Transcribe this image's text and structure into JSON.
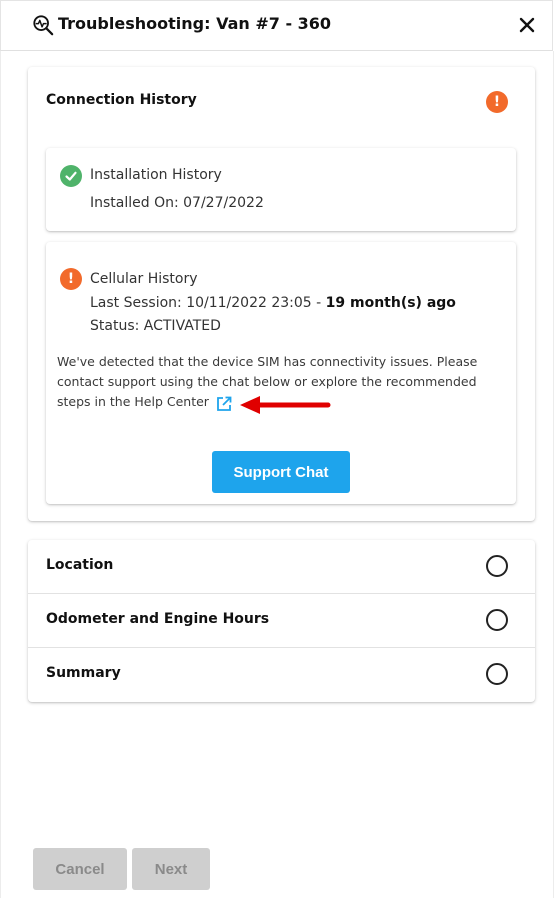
{
  "header": {
    "title": "Troubleshooting: Van #7 - 360",
    "icon": "diagnostic-magnifier-icon",
    "close_icon": "close-icon"
  },
  "connection_history": {
    "title": "Connection History",
    "status": "warning",
    "installation": {
      "title": "Installation History",
      "installed_on": "Installed On: 07/27/2022",
      "status": "success"
    },
    "cellular": {
      "title": "Cellular History",
      "last_session_prefix": "Last Session: 10/11/2022 23:05 - ",
      "last_session_ago": "19 month(s) ago",
      "status_text": "Status: ACTIVATED",
      "status": "warning",
      "message_line1": "We've detected that the device SIM has connectivity issues. Please",
      "message_line2": "contact support using the chat below or explore the recommended",
      "message_line3": "steps in the Help Center",
      "link_icon": "external-link-icon",
      "support_button": "Support Chat"
    }
  },
  "sections": [
    {
      "title": "Location",
      "status": "pending"
    },
    {
      "title": "Odometer and Engine Hours",
      "status": "pending"
    },
    {
      "title": "Summary",
      "status": "pending"
    }
  ],
  "footer": {
    "cancel_label": "Cancel",
    "next_label": "Next"
  },
  "colors": {
    "warning": "#f26a2b",
    "success": "#4fb36a",
    "primary": "#1ea4ec",
    "annotation_arrow": "#e00000",
    "disabled": "#cfcfcf"
  }
}
